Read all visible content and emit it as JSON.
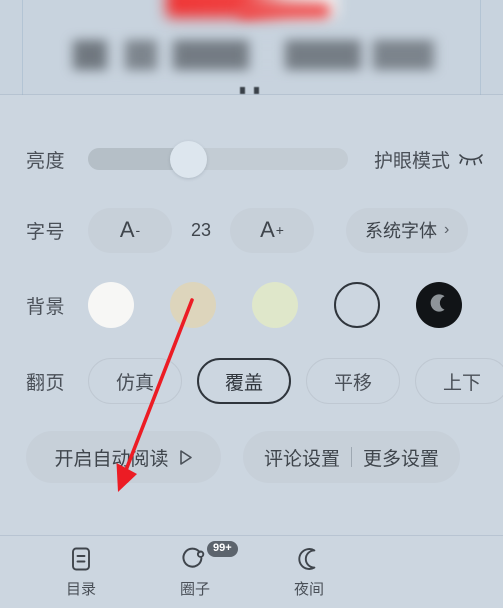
{
  "reader_preview": {
    "name": "blurred-book-content",
    "page_indicator_dots": 2
  },
  "settings": {
    "brightness": {
      "label": "亮度",
      "slider_value_percent": 41,
      "eyecare_label": "护眼模式",
      "eyecare_icon": "closed-eye-icon"
    },
    "font_size": {
      "label": "字号",
      "decrease_label": "A",
      "decrease_sup": "-",
      "increase_label": "A",
      "increase_sup": "+",
      "value": "23",
      "system_font_label": "系统字体",
      "chevron": "›"
    },
    "background": {
      "label": "背景",
      "swatches": [
        {
          "name": "white",
          "color": "#f7f7f5",
          "selected": false
        },
        {
          "name": "beige",
          "color": "#ddd5bc",
          "selected": false
        },
        {
          "name": "green",
          "color": "#dfe7ca",
          "selected": false
        },
        {
          "name": "outline",
          "color": "transparent",
          "selected": true
        },
        {
          "name": "night",
          "color": "#111417",
          "selected": false
        }
      ]
    },
    "page_turn": {
      "label": "翻页",
      "options": [
        {
          "label": "仿真",
          "selected": false
        },
        {
          "label": "覆盖",
          "selected": true
        },
        {
          "label": "平移",
          "selected": false
        },
        {
          "label": "上下",
          "selected": false
        }
      ]
    },
    "actions": {
      "auto_read_label": "开启自动阅读",
      "auto_read_icon": "play-icon",
      "comment_settings_label": "评论设置",
      "more_settings_label": "更多设置"
    }
  },
  "bottom_nav": {
    "items": [
      {
        "label": "目录",
        "icon": "document-list-icon",
        "badge": ""
      },
      {
        "label": "圈子",
        "icon": "circle-dot-icon",
        "badge": "99+"
      },
      {
        "label": "夜间",
        "icon": "moon-icon",
        "badge": ""
      }
    ]
  },
  "annotation": {
    "arrow_color": "#ec1c24",
    "points_to": "开启自动阅读"
  },
  "colors": {
    "panel_background": "#ccd6e0",
    "pill_fill": "#c7d0d9",
    "text_primary": "#3f454c",
    "text_secondary": "#4a5058",
    "selected_border": "#2f353c"
  }
}
